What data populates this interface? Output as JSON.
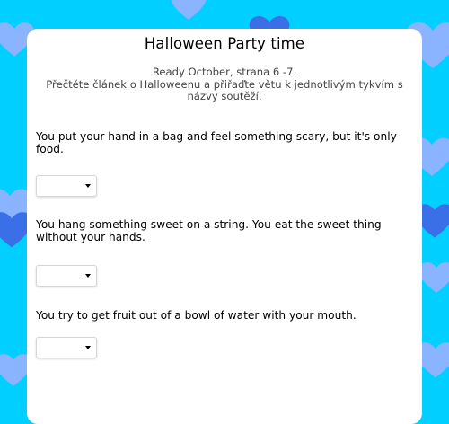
{
  "title": "Halloween Party time",
  "instructions": {
    "line1": "Ready October, strana 6 -7.",
    "line2": "Přečtěte článek o Halloweenu a přiřaďte větu k jednotlivým tykvím s názvy soutěží."
  },
  "questions": [
    {
      "text": "You put your hand in a bag and feel something scary, but it's only food.",
      "selected": ""
    },
    {
      "text": "You hang something sweet on a string. You eat the sweet thing without your hands.",
      "selected": ""
    },
    {
      "text": "You try to get fruit out of a bowl of water with your mouth.",
      "selected": ""
    }
  ],
  "colors": {
    "background": "#00cfff",
    "heart_light": "#8ab4ff",
    "heart_dark": "#3b6fe8",
    "card": "#ffffff"
  },
  "icons": {
    "background_decoration": "heart-icon",
    "dropdown_caret": "caret-down-icon"
  }
}
